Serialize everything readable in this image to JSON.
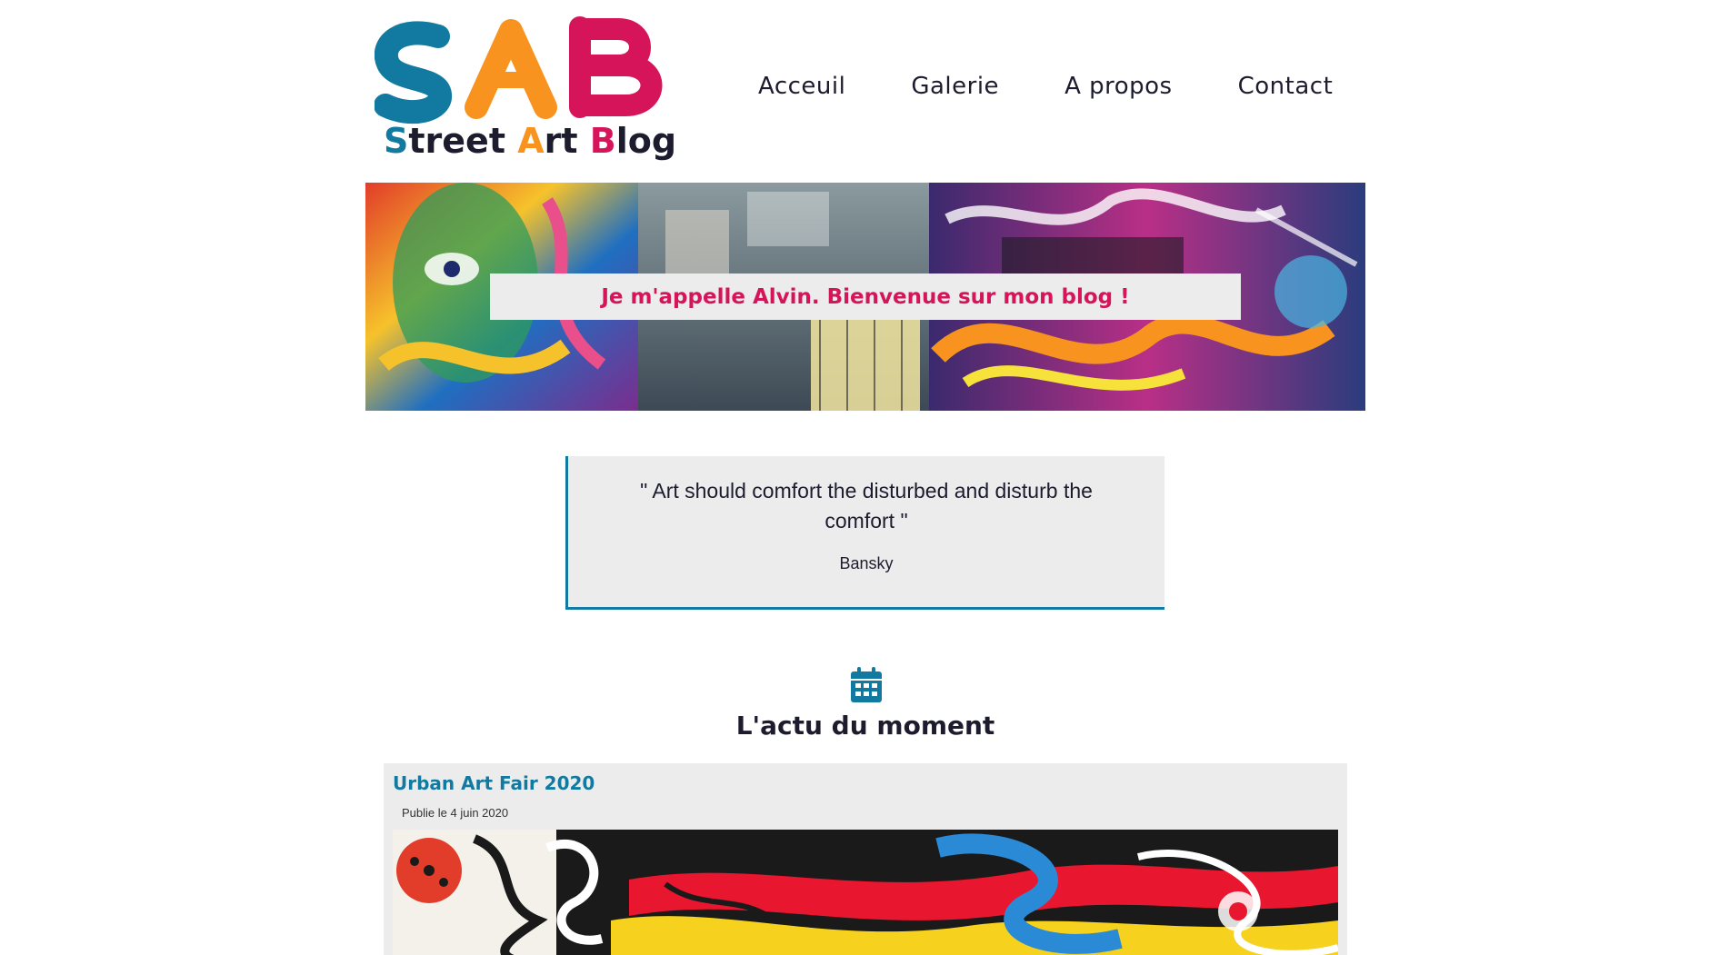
{
  "logo": {
    "letters": "SAB",
    "text_parts": [
      "S",
      "treet ",
      "A",
      "rt ",
      "B",
      "log"
    ]
  },
  "nav": {
    "items": [
      {
        "label": "Acceuil"
      },
      {
        "label": "Galerie"
      },
      {
        "label": "A propos"
      },
      {
        "label": "Contact"
      }
    ]
  },
  "banner": {
    "message": "Je m'appelle Alvin. Bienvenue sur mon blog !"
  },
  "quote": {
    "text": "\" Art should comfort the disturbed and disturb the comfort \"",
    "author": "Bansky"
  },
  "news": {
    "icon": "calendar-icon",
    "title": "L'actu du moment",
    "articles": [
      {
        "title": "Urban Art Fair 2020",
        "date": "Publie le 4 juin 2020"
      }
    ]
  },
  "colors": {
    "teal": "#127aa0",
    "orange": "#f7931e",
    "pink": "#d5145a",
    "dark": "#1c1c2e",
    "panel": "#ececec"
  }
}
